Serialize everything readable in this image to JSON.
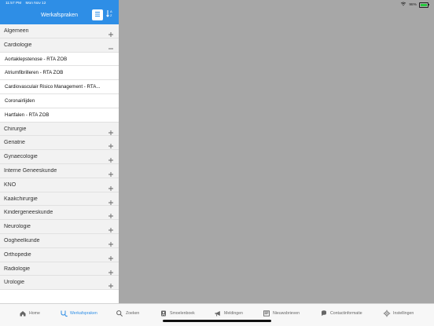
{
  "status_bar": {
    "time": "11:57 PM",
    "date": "Mon Nov 12",
    "battery": "98%",
    "battery_level": 0.98
  },
  "header": {
    "title": "Werkafspraken"
  },
  "categories": [
    {
      "label": "Algemeen",
      "expanded": false
    },
    {
      "label": "Cardiologie",
      "expanded": true,
      "items": [
        "Aortaklepstenose - RTA ZOB",
        "Atriumfibrilleren - RTA ZOB",
        "Cardiovasculair Risico Management - RTA...",
        "Coronairlijden",
        "Hartfalen - RTA ZOB"
      ]
    },
    {
      "label": "Chirurgie",
      "expanded": false
    },
    {
      "label": "Geriatrie",
      "expanded": false
    },
    {
      "label": "Gynaecologie",
      "expanded": false
    },
    {
      "label": "Interne Geneeskunde",
      "expanded": false
    },
    {
      "label": "KNO",
      "expanded": false
    },
    {
      "label": "Kaakchirurgie",
      "expanded": false
    },
    {
      "label": "Kindergeneeskunde",
      "expanded": false
    },
    {
      "label": "Neurologie",
      "expanded": false
    },
    {
      "label": "Oogheelkunde",
      "expanded": false
    },
    {
      "label": "Orthopedie",
      "expanded": false
    },
    {
      "label": "Radiologie",
      "expanded": false
    },
    {
      "label": "Urologie",
      "expanded": false
    }
  ],
  "tabbar": {
    "items": [
      {
        "label": "Home",
        "icon": "house-icon",
        "active": false
      },
      {
        "label": "Werkafspraken",
        "icon": "stethoscope-icon",
        "active": true
      },
      {
        "label": "Zoeken",
        "icon": "search-icon",
        "active": false
      },
      {
        "label": "Smoelenboek",
        "icon": "person-badge-icon",
        "active": false
      },
      {
        "label": "Meldingen",
        "icon": "megaphone-icon",
        "active": false
      },
      {
        "label": "Nieuwsbrieven",
        "icon": "newspaper-icon",
        "active": false
      },
      {
        "label": "Contactinformatie",
        "icon": "chat-bubble-icon",
        "active": false
      },
      {
        "label": "Instellingen",
        "icon": "gear-icon",
        "active": false
      }
    ]
  },
  "colors": {
    "accent": "#2E8EE6",
    "right_pane": "#A7A7A7"
  }
}
